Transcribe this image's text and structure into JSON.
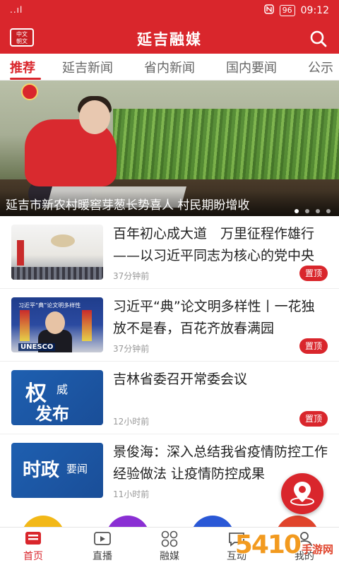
{
  "status_bar": {
    "signal": "..ıl",
    "battery": "96",
    "time": "09:12"
  },
  "header": {
    "logo_line1": "中文",
    "logo_line2": "朝文",
    "title": "延吉融媒"
  },
  "tabs": [
    {
      "label": "推荐",
      "active": true
    },
    {
      "label": "延吉新闻"
    },
    {
      "label": "省内新闻"
    },
    {
      "label": "国内要闻"
    },
    {
      "label": "公示"
    }
  ],
  "banner": {
    "caption": "延吉市新农村暖窖芽葱长势喜人  村民期盼增收",
    "slides": 4,
    "active_slide": 0
  },
  "news": [
    {
      "title": "百年初心成大道　万里征程作雄行——以习近平同志为核心的党中央",
      "time": "37分钟前",
      "pin": "置顶"
    },
    {
      "title": "习近平“典”论文明多样性丨一花独放不是春，百花齐放春满园",
      "time": "37分钟前",
      "pin": "置顶",
      "thumb_header": "习近平“典”论文明多样性",
      "thumb_logo": "UNESCO"
    },
    {
      "title": "吉林省委召开常委会议",
      "time": "12小时前",
      "pin": "置顶",
      "thumb_big": "权",
      "thumb_small1": "威",
      "thumb_small2": "发布"
    },
    {
      "title": "景俊海：深入总结我省疫情防控工作经验做法 让疫情防控成果",
      "time": "11小时前",
      "thumb_big": "时政",
      "thumb_small": "要闻"
    }
  ],
  "bottom_nav": [
    {
      "label": "首页",
      "icon": "news-icon",
      "active": true
    },
    {
      "label": "直播",
      "icon": "live-icon"
    },
    {
      "label": "融媒",
      "icon": "grid-icon"
    },
    {
      "label": "互动",
      "icon": "chat-icon"
    },
    {
      "label": "我的",
      "icon": "user-icon"
    }
  ],
  "watermark": {
    "number": "5410",
    "text": "手游网"
  },
  "colors": {
    "brand": "#d9262c"
  }
}
